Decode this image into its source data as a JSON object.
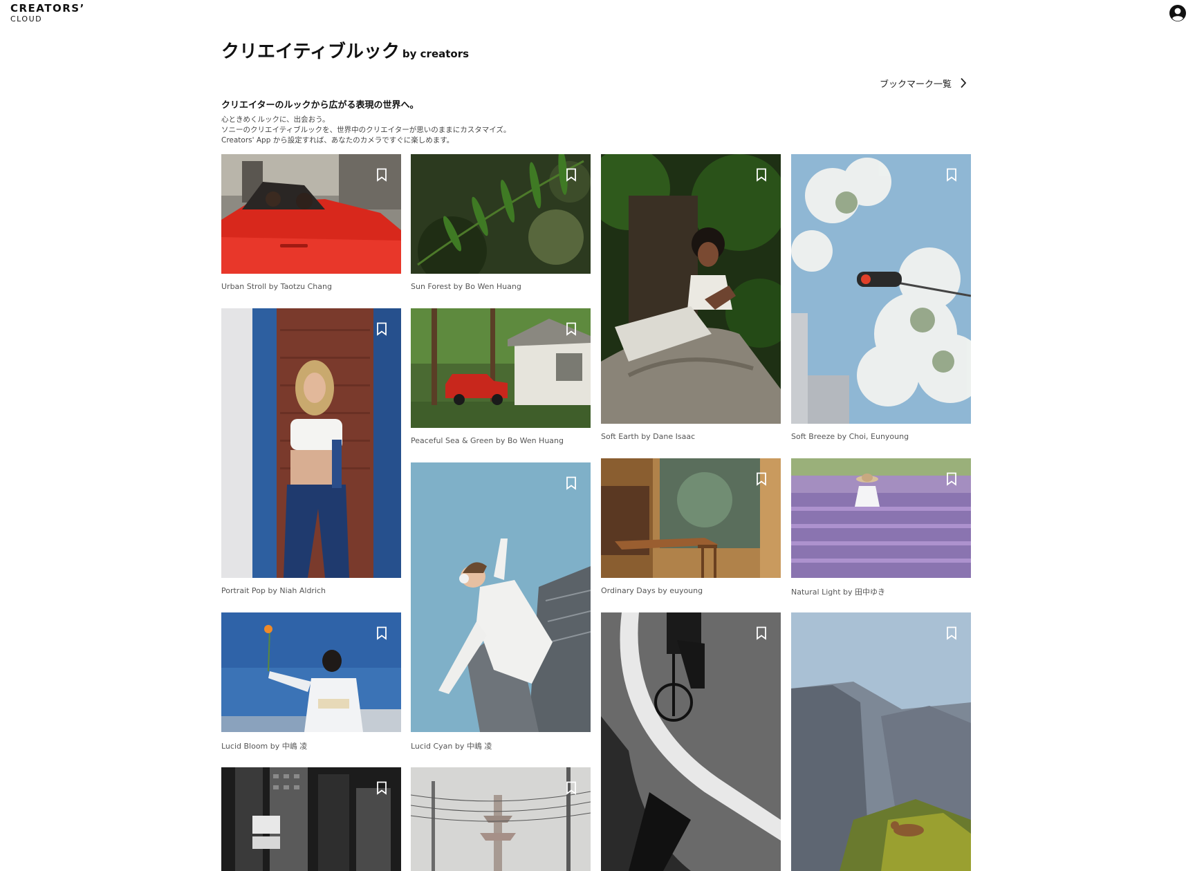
{
  "header": {
    "logo_line1": "CREATORS’",
    "logo_line2": "CLOUD"
  },
  "page": {
    "title": "クリエイティブルック",
    "title_suffix": "by creators",
    "bookmarks_link": "ブックマーク一覧",
    "headline": "クリエイターのルックから広がる表現の世界へ。",
    "description": [
      "心ときめくルックに、出会おう。",
      "ソニーのクリエイティブルックを、世界中のクリエイターが思いのままにカスタマイズ。",
      "Creators' App から設定すれば、あなたのカメラですぐに楽しめます。"
    ]
  },
  "looks": [
    {
      "caption": "Urban Stroll by Taotzu Chang",
      "image": "red convertible with two dogs on a city street"
    },
    {
      "caption": "Sun Forest by Bo Wen Huang",
      "image": "fern leaf with soft green bokeh"
    },
    {
      "caption": "Soft Earth by Dane Isaac",
      "image": "woman leaning on a large rock in a forest"
    },
    {
      "caption": "Soft Breeze by Choi, Eunyoung",
      "image": "white blossoms and traffic light against blue sky"
    },
    {
      "caption": "Portrait Pop by Niah Aldrich",
      "image": "woman in overalls against a brick wall"
    },
    {
      "caption": "Peaceful Sea & Green by Bo Wen Huang",
      "image": "red pickup truck under trees by a house"
    },
    {
      "caption": "Ordinary Days by euyoung",
      "image": "cafe interior with window light"
    },
    {
      "caption": "Natural Light by 田中ゆき",
      "image": "girl with straw hat in a lavender field"
    },
    {
      "caption": "Lucid Bloom by 中嶋 凌",
      "image": "woman in white kimono holding a flower"
    },
    {
      "caption": "Lucid Cyan by 中嶋 凌",
      "image": "woman in white leaping in front of skyscrapers"
    },
    {
      "caption": "",
      "image": "black and white cyclist on a curved road"
    },
    {
      "caption": "",
      "image": "granite cliffs in a mountain valley with a deer"
    },
    {
      "caption": "",
      "image": "black and white skyscrapers with street signs"
    },
    {
      "caption": "",
      "image": "misty pagoda with power lines"
    }
  ]
}
